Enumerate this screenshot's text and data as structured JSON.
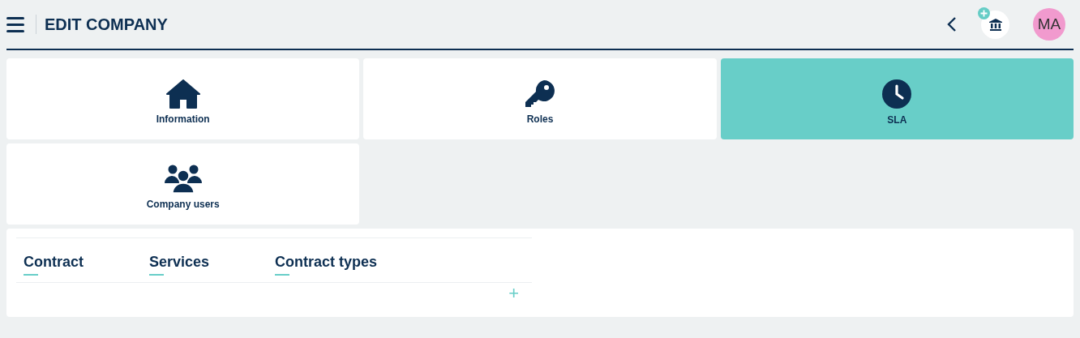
{
  "header": {
    "title": "EDIT COMPANY",
    "avatar": "MA"
  },
  "tiles": [
    {
      "label": "Information",
      "kind": "home",
      "selected": false
    },
    {
      "label": "Roles",
      "kind": "key",
      "selected": false
    },
    {
      "label": "SLA",
      "kind": "clock",
      "selected": true
    },
    {
      "label": "Company users",
      "kind": "users",
      "selected": false
    }
  ],
  "tabs": [
    "Contract",
    "Services",
    "Contract types"
  ],
  "add_button": "+"
}
